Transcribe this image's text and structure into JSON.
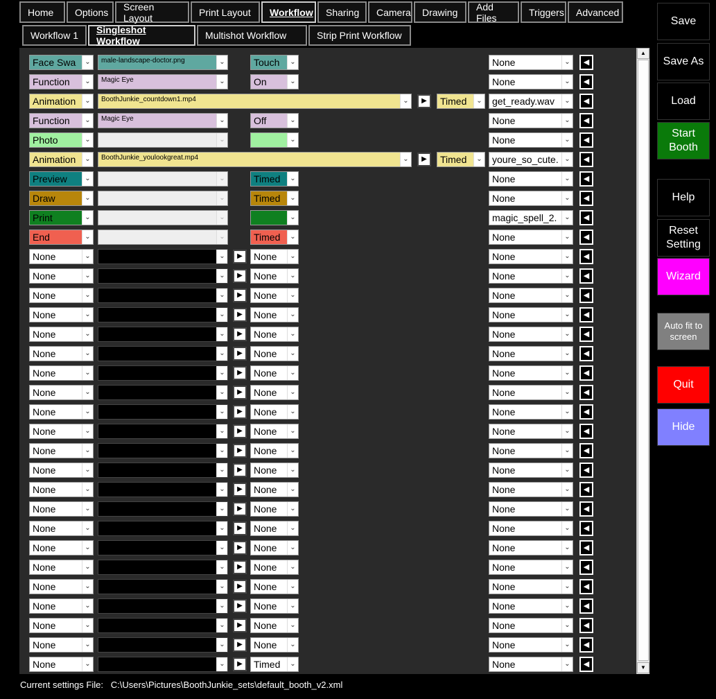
{
  "tabs": [
    {
      "label": "Home",
      "active": false
    },
    {
      "label": "Options",
      "active": false
    },
    {
      "label": "Screen Layout",
      "active": false
    },
    {
      "label": "Print Layout",
      "active": false
    },
    {
      "label": "Workflow",
      "active": true
    },
    {
      "label": "Sharing",
      "active": false
    },
    {
      "label": "Camera",
      "active": false
    },
    {
      "label": "Drawing",
      "active": false
    },
    {
      "label": "Add Files",
      "active": false
    },
    {
      "label": "Triggers",
      "active": false
    },
    {
      "label": "Advanced",
      "active": false
    }
  ],
  "subtabs": [
    {
      "label": "Workflow 1",
      "active": false
    },
    {
      "label": "Singleshot Workflow",
      "active": true
    },
    {
      "label": "Multishot Workflow",
      "active": false
    },
    {
      "label": "Strip Print Workflow",
      "active": false
    }
  ],
  "colors": {
    "teal_light": "#5fa8a0",
    "lilac": "#d8c0dc",
    "yellow": "#f0e490",
    "green_light": "#a0f0a0",
    "teal_dark": "#0f8080",
    "gold": "#b8860b",
    "green": "#0f8020",
    "red": "#f06050"
  },
  "workflow_rows": [
    {
      "action": "Face Swa",
      "action_color": "#5fa8a0",
      "file": "male-landscape-doctor.png",
      "file_color": "#5fa8a0",
      "file_width": "short",
      "trigger": "Touch",
      "trigger_color": "#5fa8a0",
      "sound": "None"
    },
    {
      "action": "Function",
      "action_color": "#d8c0dc",
      "file": "Magic Eye",
      "file_color": "#d8c0dc",
      "file_width": "short",
      "trigger": "On",
      "trigger_color": "#d8c0dc",
      "sound": "None"
    },
    {
      "action": "Animation",
      "action_color": "#f0e490",
      "file": "BoothJunkie_countdown1.mp4",
      "file_color": "#f0e490",
      "file_width": "long",
      "trigger": "Timed",
      "trigger_color": "#f0e490",
      "sound": "get_ready.wav"
    },
    {
      "action": "Function",
      "action_color": "#d8c0dc",
      "file": "Magic Eye",
      "file_color": "#d8c0dc",
      "file_width": "short",
      "trigger": "Off",
      "trigger_color": "#d8c0dc",
      "sound": "None"
    },
    {
      "action": "Photo",
      "action_color": "#a0f0a0",
      "file": "",
      "file_color": "disabled",
      "file_width": "short",
      "trigger": "",
      "trigger_color": "#a0f0a0",
      "sound": "None"
    },
    {
      "action": "Animation",
      "action_color": "#f0e490",
      "file": "BoothJunkie_youlookgreat.mp4",
      "file_color": "#f0e490",
      "file_width": "long",
      "trigger": "Timed",
      "trigger_color": "#f0e490",
      "sound": "youre_so_cute."
    },
    {
      "action": "Preview",
      "action_color": "#0f8080",
      "file": "",
      "file_color": "disabled",
      "file_width": "short",
      "trigger": "Timed",
      "trigger_color": "#0f8080",
      "sound": "None"
    },
    {
      "action": "Draw",
      "action_color": "#b8860b",
      "file": "",
      "file_color": "disabled",
      "file_width": "short",
      "trigger": "Timed",
      "trigger_color": "#b8860b",
      "sound": "None"
    },
    {
      "action": "Print",
      "action_color": "#0f8020",
      "file": "",
      "file_color": "disabled",
      "file_width": "short",
      "trigger": "",
      "trigger_color": "#0f8020",
      "sound": "magic_spell_2."
    },
    {
      "action": "End",
      "action_color": "#f06050",
      "file": "",
      "file_color": "disabled",
      "file_width": "short",
      "trigger": "Timed",
      "trigger_color": "#f06050",
      "sound": "None"
    }
  ],
  "empty_rows": {
    "action": "None",
    "trigger": "None",
    "sound": "None",
    "last_trigger": "Timed"
  },
  "side_buttons": [
    {
      "label": "Save",
      "color": "#000000"
    },
    {
      "label": "Save As",
      "color": "#000000"
    },
    {
      "label": "Load",
      "color": "#000000"
    },
    {
      "label": "Start Booth",
      "color": "#0a7a0a"
    },
    {
      "label": "Help",
      "color": "#000000"
    },
    {
      "label": "Reset Setting",
      "color": "#000000"
    },
    {
      "label": "Wizard",
      "color": "#ff00ff"
    },
    {
      "label": "Auto fit to screen",
      "color": "#808080"
    },
    {
      "label": "Quit",
      "color": "#ff0000"
    },
    {
      "label": "Hide",
      "color": "#8080ff"
    }
  ],
  "status": {
    "label": "Current settings File:",
    "path": "C:\\Users\\Pictures\\BoothJunkie_sets\\default_booth_v2.xml"
  }
}
